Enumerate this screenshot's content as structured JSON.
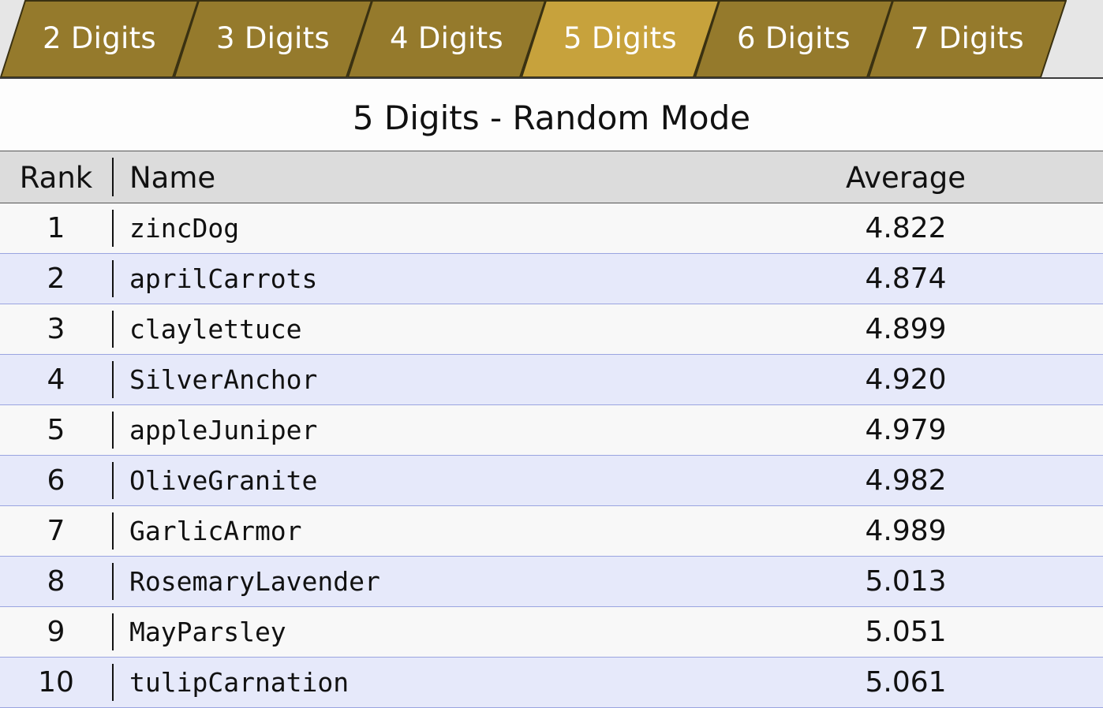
{
  "tabs": [
    {
      "label": "2 Digits",
      "active": false
    },
    {
      "label": "3 Digits",
      "active": false
    },
    {
      "label": "4 Digits",
      "active": false
    },
    {
      "label": "5 Digits",
      "active": true
    },
    {
      "label": "6 Digits",
      "active": false
    },
    {
      "label": "7 Digits",
      "active": false
    }
  ],
  "colors": {
    "tab": "#957a2c",
    "tab_active": "#c7a23c",
    "tab_border": "#3a3111",
    "row_odd": "#f8f8f8",
    "row_even": "#e6e9fa"
  },
  "title": "5 Digits - Random Mode",
  "columns": {
    "rank": "Rank",
    "name": "Name",
    "average": "Average"
  },
  "rows": [
    {
      "rank": "1",
      "name": "zincDog",
      "average": "4.822"
    },
    {
      "rank": "2",
      "name": "aprilCarrots",
      "average": "4.874"
    },
    {
      "rank": "3",
      "name": "claylettuce",
      "average": "4.899"
    },
    {
      "rank": "4",
      "name": "SilverAnchor",
      "average": "4.920"
    },
    {
      "rank": "5",
      "name": "appleJuniper",
      "average": "4.979"
    },
    {
      "rank": "6",
      "name": "OliveGranite",
      "average": "4.982"
    },
    {
      "rank": "7",
      "name": "GarlicArmor",
      "average": "4.989"
    },
    {
      "rank": "8",
      "name": "RosemaryLavender",
      "average": "5.013"
    },
    {
      "rank": "9",
      "name": "MayParsley",
      "average": "5.051"
    },
    {
      "rank": "10",
      "name": "tulipCarnation",
      "average": "5.061"
    }
  ]
}
